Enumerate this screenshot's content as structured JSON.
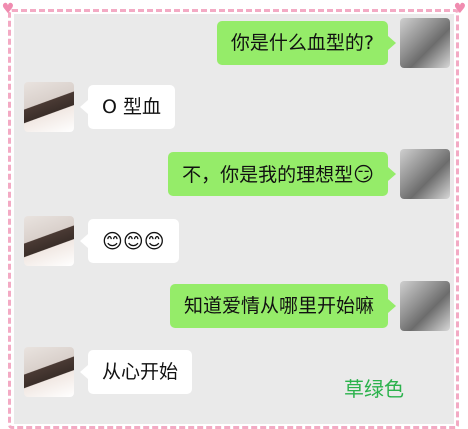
{
  "chat": {
    "messages": [
      {
        "sender": "me",
        "text": "你是什么血型的?"
      },
      {
        "sender": "her",
        "text": "O 型血"
      },
      {
        "sender": "me",
        "text": "不，你是我的理想型",
        "emoji": "😏"
      },
      {
        "sender": "her",
        "text": "😊😊😊"
      },
      {
        "sender": "me",
        "text": "知道爱情从哪里开始嘛"
      },
      {
        "sender": "her",
        "text": "从心开始"
      }
    ]
  },
  "watermark": "草绿色",
  "colors": {
    "me_bubble": "#95ec69",
    "her_bubble": "#ffffff",
    "chat_bg": "#eaeaea",
    "border": "#f3aac4",
    "watermark": "#2bb24c"
  },
  "icons": {
    "heart": "heart-icon",
    "avatar_me": "avatar-photo",
    "avatar_her": "avatar-photo"
  }
}
